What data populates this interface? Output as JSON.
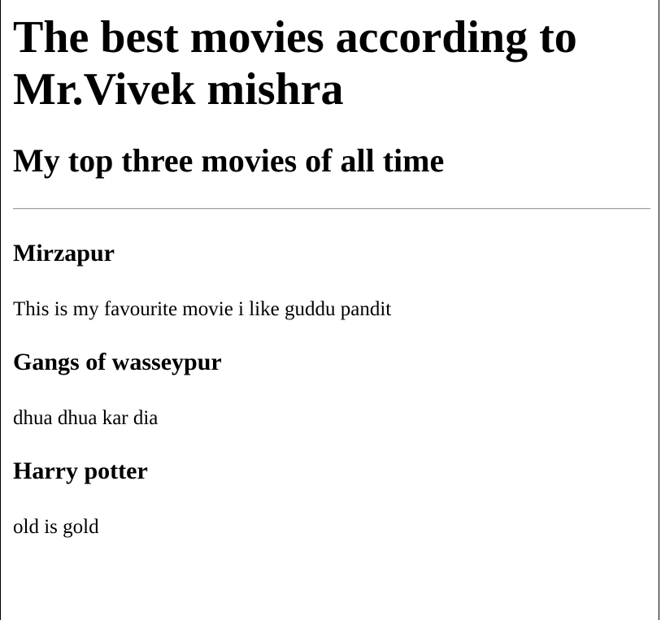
{
  "page": {
    "title": "The best movies according to Mr.Vivek mishra",
    "subtitle": "My top three movies of all time"
  },
  "movies": [
    {
      "name": "Mirzapur",
      "description": "This is my favourite movie i like guddu pandit"
    },
    {
      "name": "Gangs of wasseypur",
      "description": "dhua dhua kar dia"
    },
    {
      "name": "Harry potter",
      "description": "old is gold"
    }
  ],
  "colors": {
    "background": "#ffffff",
    "text": "#000000",
    "divider": "#a0a0a0"
  }
}
